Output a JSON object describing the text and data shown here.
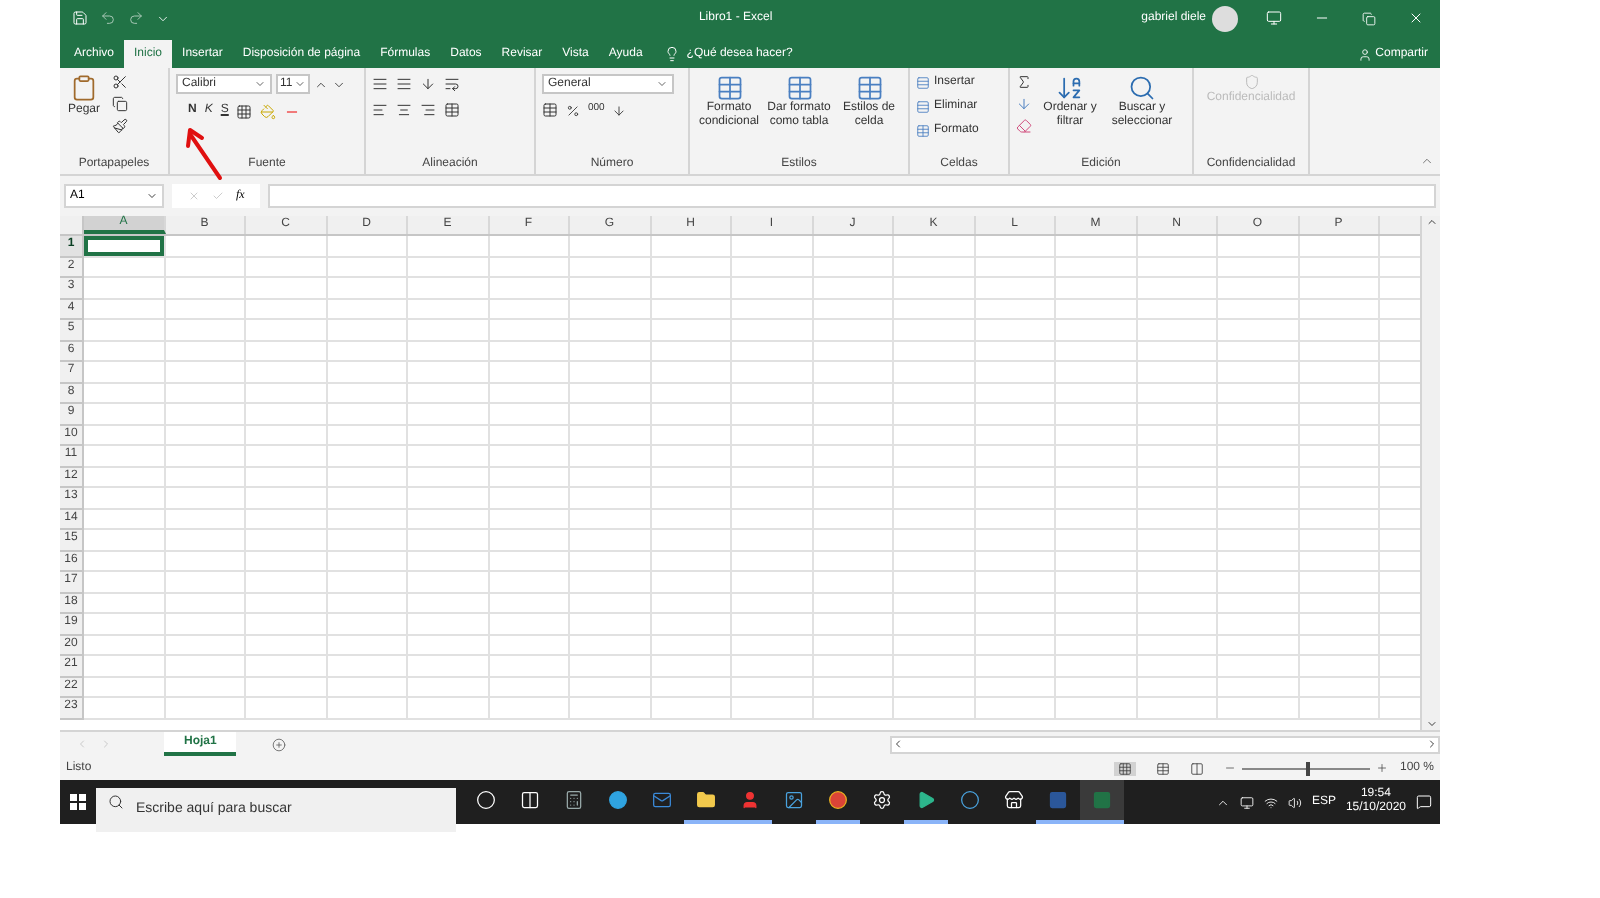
{
  "title_bar": {
    "title": "Libro1 - Excel",
    "user": "gabriel diele"
  },
  "ribbon_tabs": [
    {
      "label": "Archivo",
      "selected": false
    },
    {
      "label": "Inicio",
      "selected": true
    },
    {
      "label": "Insertar",
      "selected": false
    },
    {
      "label": "Disposición de página",
      "selected": false
    },
    {
      "label": "Fórmulas",
      "selected": false
    },
    {
      "label": "Datos",
      "selected": false
    },
    {
      "label": "Revisar",
      "selected": false
    },
    {
      "label": "Vista",
      "selected": false
    },
    {
      "label": "Ayuda",
      "selected": false
    }
  ],
  "tell_me": {
    "placeholder": "¿Qué desea hacer?"
  },
  "share": "Compartir",
  "ribbon": {
    "clipboard": {
      "label": "Portapapeles",
      "paste": "Pegar"
    },
    "font": {
      "label": "Fuente",
      "family": "Calibri",
      "size": "11",
      "bold": "N",
      "italic": "K",
      "underline": "S"
    },
    "alignment": {
      "label": "Alineación"
    },
    "number": {
      "label": "Número",
      "format": "General",
      "thousands": "000"
    },
    "styles": {
      "label": "Estilos",
      "buttons": [
        "Formato condicional",
        "Dar formato como tabla",
        "Estilos de celda"
      ]
    },
    "cells": {
      "label": "Celdas",
      "buttons": [
        "Insertar",
        "Eliminar",
        "Formato"
      ]
    },
    "editing": {
      "label": "Edición",
      "buttons": [
        "Ordenar y filtrar",
        "Buscar y seleccionar"
      ]
    },
    "sensitivity": {
      "label": "Confidencialidad",
      "button": "Confidencialidad",
      "disabled": true
    }
  },
  "formula_bar": {
    "name_box": "A1",
    "function_label": "fx"
  },
  "grid": {
    "columns": [
      {
        "label": "A",
        "selected": true
      },
      {
        "label": "B",
        "selected": false
      },
      {
        "label": "C",
        "selected": false
      },
      {
        "label": "D",
        "selected": false
      },
      {
        "label": "E",
        "selected": false
      },
      {
        "label": "F",
        "selected": false
      },
      {
        "label": "G",
        "selected": false
      },
      {
        "label": "H",
        "selected": false
      },
      {
        "label": "I",
        "selected": false
      },
      {
        "label": "J",
        "selected": false
      },
      {
        "label": "K",
        "selected": false
      },
      {
        "label": "L",
        "selected": false
      },
      {
        "label": "M",
        "selected": false
      },
      {
        "label": "N",
        "selected": false
      },
      {
        "label": "O",
        "selected": false
      },
      {
        "label": "P",
        "selected": false
      }
    ],
    "rows": [
      {
        "label": "1",
        "selected": true
      },
      {
        "label": "2",
        "selected": false
      },
      {
        "label": "3",
        "selected": false
      },
      {
        "label": "4",
        "selected": false
      },
      {
        "label": "5",
        "selected": false
      },
      {
        "label": "6",
        "selected": false
      },
      {
        "label": "7",
        "selected": false
      },
      {
        "label": "8",
        "selected": false
      },
      {
        "label": "9",
        "selected": false
      },
      {
        "label": "10",
        "selected": false
      },
      {
        "label": "11",
        "selected": false
      },
      {
        "label": "12",
        "selected": false
      },
      {
        "label": "13",
        "selected": false
      },
      {
        "label": "14",
        "selected": false
      },
      {
        "label": "15",
        "selected": false
      },
      {
        "label": "16",
        "selected": false
      },
      {
        "label": "17",
        "selected": false
      },
      {
        "label": "18",
        "selected": false
      },
      {
        "label": "19",
        "selected": false
      },
      {
        "label": "20",
        "selected": false
      },
      {
        "label": "21",
        "selected": false
      },
      {
        "label": "22",
        "selected": false
      },
      {
        "label": "23",
        "selected": false
      }
    ]
  },
  "sheet_tabs": [
    {
      "label": "Hoja1",
      "selected": true
    }
  ],
  "status_bar": {
    "status": "Listo",
    "zoom": "100 %",
    "zoom_slider": {
      "level": 0.5
    }
  },
  "taskbar": {
    "search": {
      "placeholder": "Escribe aquí para buscar"
    },
    "apps": [
      {
        "kind": "cortana",
        "open": false,
        "selected": false
      },
      {
        "kind": "task-view",
        "open": false,
        "selected": false
      },
      {
        "kind": "calculator",
        "open": false,
        "selected": false
      },
      {
        "kind": "edge",
        "open": false,
        "selected": false
      },
      {
        "kind": "mail",
        "open": false,
        "selected": false
      },
      {
        "kind": "explorer",
        "open": true,
        "selected": false
      },
      {
        "kind": "game",
        "open": true,
        "selected": false
      },
      {
        "kind": "photos",
        "open": false,
        "selected": false
      },
      {
        "kind": "chrome",
        "open": true,
        "selected": false
      },
      {
        "kind": "settings",
        "open": false,
        "selected": false
      },
      {
        "kind": "terminal",
        "open": true,
        "selected": false
      },
      {
        "kind": "media",
        "open": false,
        "selected": false
      },
      {
        "kind": "store",
        "open": false,
        "selected": false
      },
      {
        "kind": "word",
        "open": true,
        "selected": false
      },
      {
        "kind": "excel",
        "open": true,
        "selected": true
      }
    ],
    "language": "ESP",
    "time": "19:54",
    "date": "15/10/2020"
  }
}
